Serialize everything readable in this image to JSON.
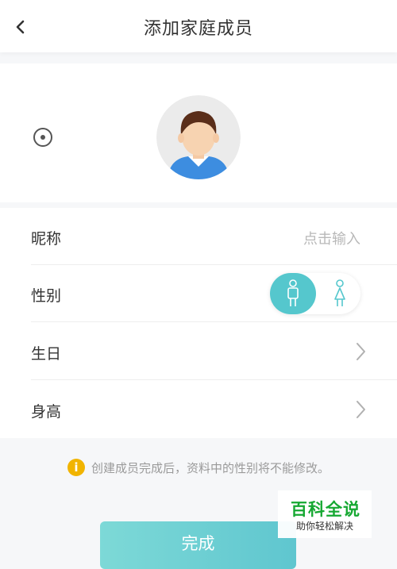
{
  "header": {
    "title": "添加家庭成员",
    "back_icon": "chevron-left-icon"
  },
  "avatar": {
    "icon": "default-avatar",
    "camera_icon": "camera-icon"
  },
  "form": {
    "nickname": {
      "label": "昵称",
      "placeholder": "点击输入"
    },
    "gender": {
      "label": "性别",
      "options": [
        "male",
        "female"
      ],
      "selected": "male",
      "male_icon": "male-person-icon",
      "female_icon": "female-person-icon"
    },
    "birthday": {
      "label": "生日",
      "icon": "chevron-right-icon"
    },
    "height": {
      "label": "身高",
      "icon": "chevron-right-icon"
    }
  },
  "notice": {
    "icon": "info-icon",
    "icon_glyph": "i",
    "text": "创建成员完成后，资料中的性别将不能修改。"
  },
  "submit": {
    "label": "完成"
  },
  "watermark": {
    "title": "百科全说",
    "subtitle": "助你轻松解决"
  },
  "colors": {
    "accent": "#55c7cd",
    "info": "#f1b400",
    "watermark_green": "#16a832"
  }
}
